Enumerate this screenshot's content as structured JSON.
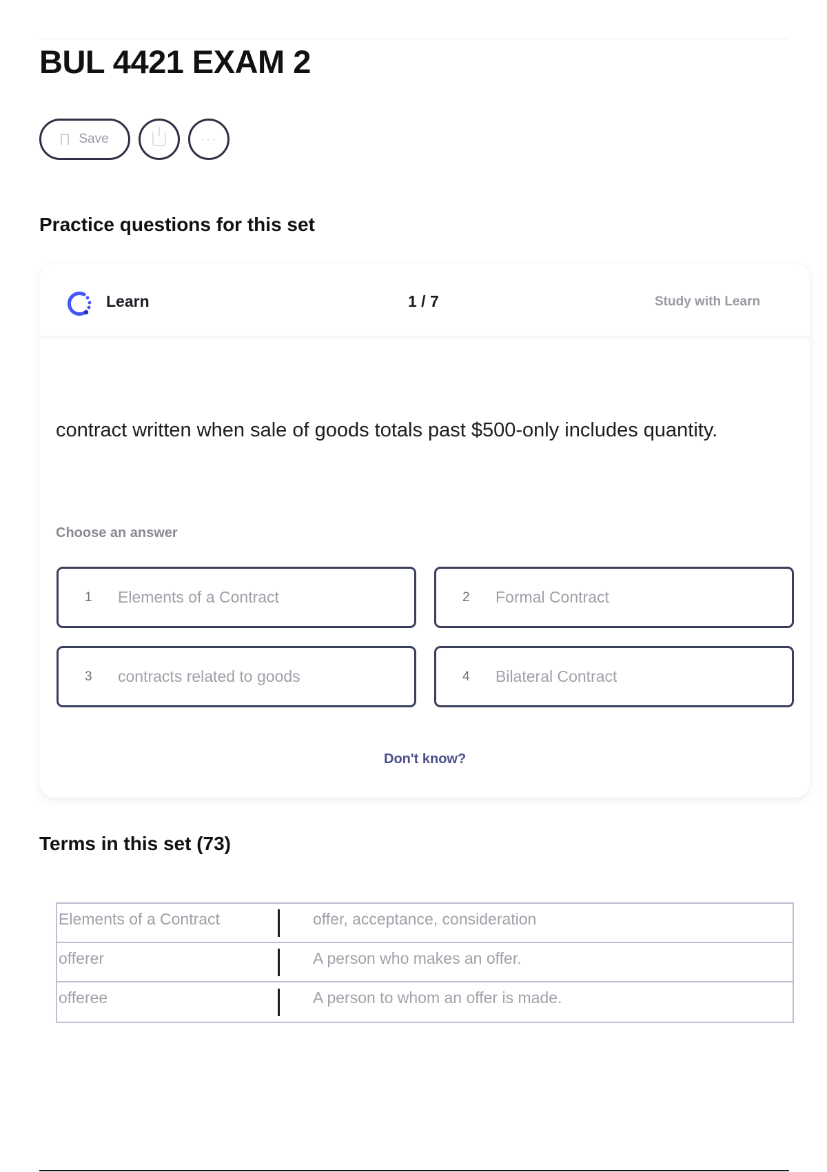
{
  "page": {
    "title": "BUL 4421 EXAM 2"
  },
  "actions": {
    "save_label": "Save",
    "share_icon": "share-icon",
    "more_icon": "more-icon",
    "more_glyph": "···"
  },
  "practice": {
    "heading": "Practice questions for this set",
    "mode_label": "Learn",
    "progress": "1 / 7",
    "study_link": "Study with Learn",
    "question": "contract written when sale of goods totals past $500-only includes quantity.",
    "choose_label": "Choose an answer",
    "options": [
      {
        "num": "1",
        "text": "Elements of a Contract"
      },
      {
        "num": "2",
        "text": "Formal Contract"
      },
      {
        "num": "3",
        "text": "contracts related to goods"
      },
      {
        "num": "4",
        "text": "Bilateral Contract"
      }
    ],
    "dont_know": "Don't know?",
    "accent_color": "#4255ff"
  },
  "terms": {
    "heading": "Terms in this set (73)",
    "rows": [
      {
        "term": "Elements of a Contract",
        "definition": "offer, acceptance, consideration"
      },
      {
        "term": "offerer",
        "definition": "A person who makes an offer."
      },
      {
        "term": "offeree",
        "definition": "A person to whom an offer is made."
      }
    ]
  }
}
